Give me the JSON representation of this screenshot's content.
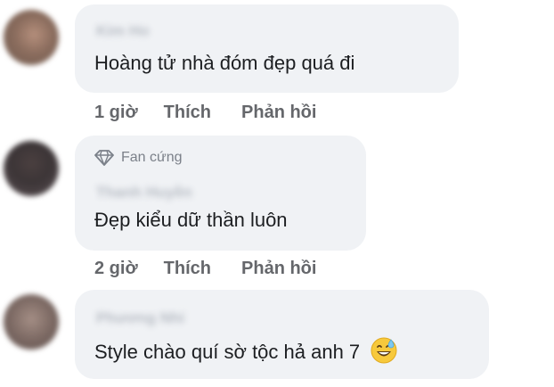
{
  "comments": [
    {
      "author": "Kim Ho",
      "text": "Hoàng tử nhà đóm đẹp quá đi",
      "badge": "",
      "time": "1 giờ",
      "like_label": "Thích",
      "reply_label": "Phản hồi"
    },
    {
      "author": "Thanh Huyền",
      "text": "Đẹp kiểu dữ thần luôn",
      "badge": "Fan cứng",
      "time": "2 giờ",
      "like_label": "Thích",
      "reply_label": "Phản hồi"
    },
    {
      "author": "Phương Nhi",
      "text": "Style chào quí sờ tộc hả anh 7",
      "badge": "",
      "emoji": "grinning-face-with-sweat-emoji"
    }
  ],
  "icons": {
    "badge_icon": "diamond-icon"
  },
  "colors": {
    "bubble_bg": "#f0f2f5",
    "text": "#1c1e21",
    "meta": "#65676b",
    "author_blurred": "#b7bcc4"
  }
}
